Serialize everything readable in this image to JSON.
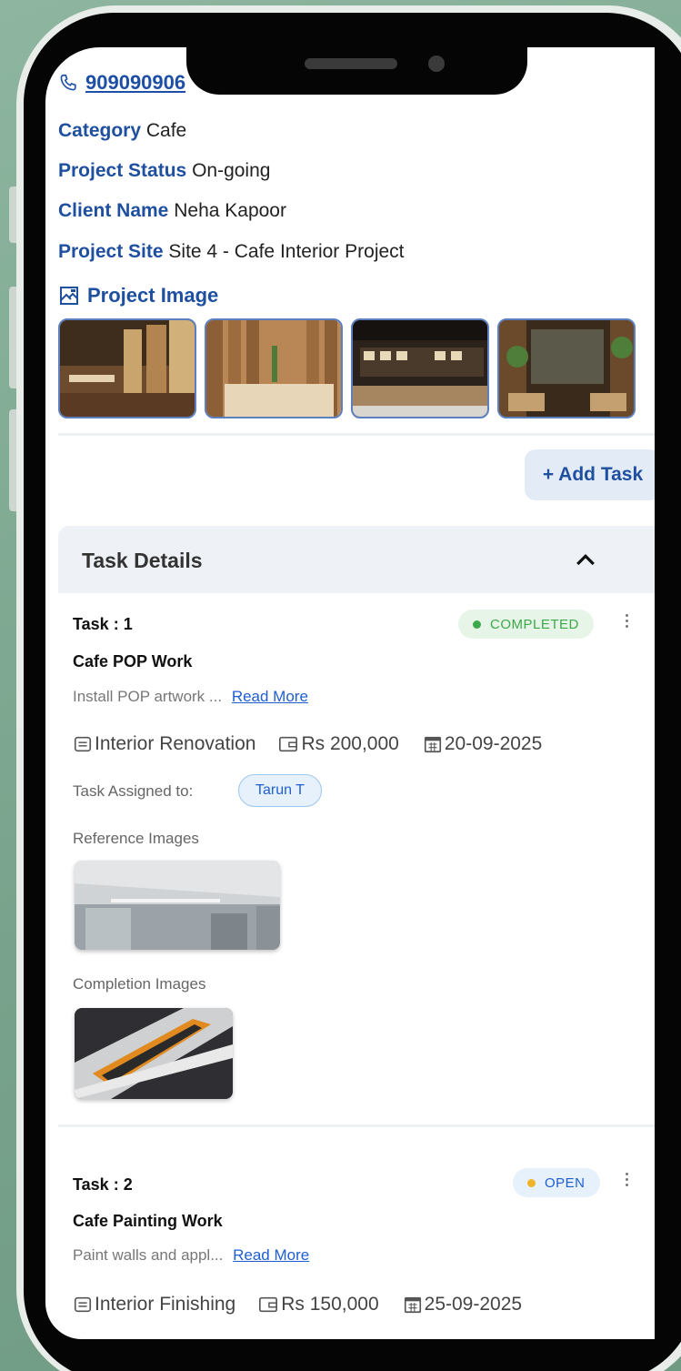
{
  "project": {
    "phone": "909090906",
    "fields": [
      {
        "label": "Category",
        "value": "Cafe"
      },
      {
        "label": "Project Status",
        "value": "On-going"
      },
      {
        "label": "Client Name",
        "value": "Neha Kapoor"
      },
      {
        "label": "Project Site",
        "value": "Site 4 - Cafe Interior Project"
      }
    ],
    "image_section_label": "Project Image"
  },
  "actions": {
    "add_task_label": "+ Add Task"
  },
  "task_section": {
    "title": "Task Details"
  },
  "tasks": [
    {
      "number_label": "Task : 1",
      "status": "COMPLETED",
      "status_color": "#3da84a",
      "name": "Cafe POP Work",
      "description": "Install POP artwork ...",
      "read_more": "Read More",
      "category": "Interior Renovation",
      "amount": "Rs 200,000",
      "date": "20-09-2025",
      "assigned_label": "Task Assigned to:",
      "assignee": "Tarun T",
      "reference_label": "Reference Images",
      "completion_label": "Completion Images"
    },
    {
      "number_label": "Task : 2",
      "status": "OPEN",
      "status_color": "#f0b429",
      "name": "Cafe Painting Work",
      "description": "Paint walls and appl...",
      "read_more": "Read More",
      "category": "Interior Finishing",
      "amount": "Rs 150,000",
      "date": "25-09-2025"
    }
  ],
  "colors": {
    "accent": "#1f4f9f",
    "link": "#1f5fd0",
    "background": "#7fa892"
  }
}
